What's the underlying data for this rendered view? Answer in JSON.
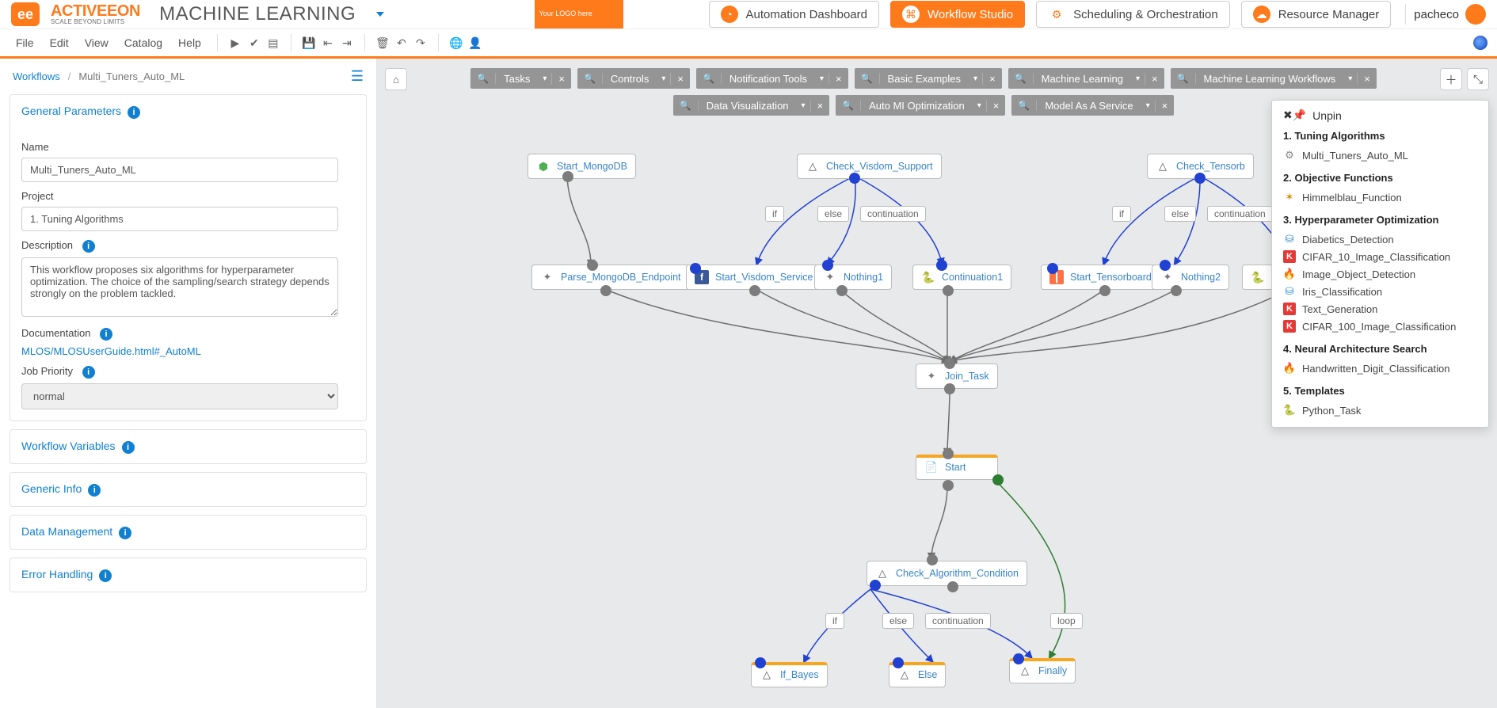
{
  "brand": {
    "name": "ACTIVEEON",
    "tag": "SCALE BEYOND LIMITS"
  },
  "app_section": "MACHINE LEARNING",
  "your_logo": "Your LOGO here",
  "nav": {
    "dashboard": "Automation Dashboard",
    "studio": "Workflow Studio",
    "sched": "Scheduling & Orchestration",
    "rm": "Resource Manager"
  },
  "user": "pacheco",
  "menus": {
    "file": "File",
    "edit": "Edit",
    "view": "View",
    "catalog": "Catalog",
    "help": "Help"
  },
  "breadcrumb": {
    "root": "Workflows",
    "current": "Multi_Tuners_Auto_ML"
  },
  "palette": [
    "Tasks",
    "Controls",
    "Notification Tools",
    "Basic Examples",
    "Machine Learning",
    "Machine Learning Workflows",
    "Data Visualization",
    "Auto MI Optimization",
    "Model As A Service"
  ],
  "panels": {
    "gp": "General Parameters",
    "wv": "Workflow Variables",
    "gi": "Generic Info",
    "dm": "Data Management",
    "eh": "Error Handling"
  },
  "form": {
    "name_label": "Name",
    "name_value": "Multi_Tuners_Auto_ML",
    "project_label": "Project",
    "project_value": "1. Tuning Algorithms",
    "desc_label": "Description",
    "desc_value": "This workflow proposes six algorithms for hyperparameter optimization. The choice of the sampling/search strategy depends strongly on the problem tackled.",
    "doc_label": "Documentation",
    "doc_link": "MLOS/MLOSUserGuide.html#_AutoML",
    "priority_label": "Job Priority",
    "priority_value": "normal"
  },
  "nodes": {
    "start_mongo": "Start_MongoDB",
    "parse_mongo": "Parse_MongoDB_Endpoint",
    "check_visdom": "Check_Visdom_Support",
    "start_visdom": "Start_Visdom_Service",
    "nothing1": "Nothing1",
    "continuation1": "Continuation1",
    "check_tb": "Check_Tensorb",
    "start_tb": "Start_Tensorboard",
    "nothing2": "Nothing2",
    "join": "Join_Task",
    "start": "Start",
    "check_algo": "Check_Algorithm_Condition",
    "if_bayes": "If_Bayes",
    "else": "Else",
    "finally": "Finally"
  },
  "branch": {
    "if": "if",
    "else": "else",
    "cont": "continuation",
    "loop": "loop"
  },
  "unpin": {
    "title": "Unpin",
    "s1": "1. Tuning Algorithms",
    "s1_items": [
      "Multi_Tuners_Auto_ML"
    ],
    "s2": "2. Objective Functions",
    "s2_items": [
      "Himmelblau_Function"
    ],
    "s3": "3. Hyperparameter Optimization",
    "s3_items": [
      "Diabetics_Detection",
      "CIFAR_10_Image_Classification",
      "Image_Object_Detection",
      "Iris_Classification",
      "Text_Generation",
      "CIFAR_100_Image_Classification"
    ],
    "s4": "4. Neural Architecture Search",
    "s4_items": [
      "Handwritten_Digit_Classification"
    ],
    "s5": "5. Templates",
    "s5_items": [
      "Python_Task"
    ]
  }
}
